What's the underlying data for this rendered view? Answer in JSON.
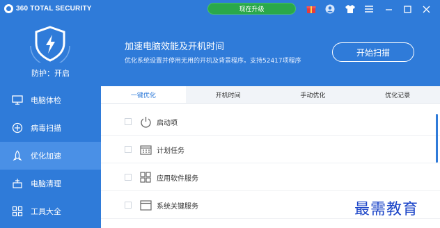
{
  "app": {
    "brand": "360 TOTAL SECURITY"
  },
  "titlebar": {
    "upgrade_label": "现在升级",
    "icons": [
      "gift-icon",
      "user-icon",
      "shirt-icon",
      "menu-icon",
      "minimize-icon",
      "maximize-icon",
      "close-icon"
    ]
  },
  "sidebar": {
    "protection_status": "防护：开启",
    "items": [
      {
        "label": "电脑体检",
        "icon": "monitor-icon"
      },
      {
        "label": "病毒扫描",
        "icon": "scan-icon"
      },
      {
        "label": "优化加速",
        "icon": "rocket-icon",
        "active": true
      },
      {
        "label": "电脑清理",
        "icon": "broom-icon"
      },
      {
        "label": "工具大全",
        "icon": "grid-icon"
      }
    ]
  },
  "banner": {
    "title": "加速电脑效能及开机时间",
    "subtitle": "优化系统设置并停用无用的开机及背景程序。支持52417项程序",
    "scan_button": "开始扫描"
  },
  "tabs": [
    {
      "label": "一键优化",
      "active": true
    },
    {
      "label": "开机时间"
    },
    {
      "label": "手动优化"
    },
    {
      "label": "优化记录"
    }
  ],
  "items": [
    {
      "label": "启动项",
      "icon": "power-icon"
    },
    {
      "label": "计划任务",
      "icon": "calendar-icon"
    },
    {
      "label": "应用软件服务",
      "icon": "apps-icon"
    },
    {
      "label": "系统关键服务",
      "icon": "window-icon"
    }
  ],
  "watermark": "最需教育",
  "colors": {
    "primary": "#2f7bd9",
    "active_nav": "#4a90e6",
    "upgrade": "#2aa84a",
    "watermark": "#1d46c8"
  }
}
